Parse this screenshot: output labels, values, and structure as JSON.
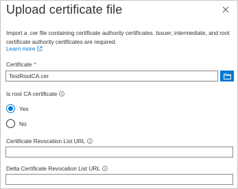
{
  "panel": {
    "title": "Upload certificate file",
    "close_icon": "close-icon",
    "description": "Import a .cer file containing certificate authority certificates. Issuer, intermediate, and root certificate authority certificates are required.",
    "learn_more": "Learn more",
    "learn_more_icon": "external-link-icon"
  },
  "form": {
    "certificate": {
      "label": "Certificate",
      "required_marker": "*",
      "value": "TestRootCA.cer",
      "browse_icon": "folder-icon"
    },
    "root_ca": {
      "label": "Is root CA certificate",
      "options": [
        "Yes",
        "No"
      ],
      "selected": "Yes"
    },
    "crl_url": {
      "label": "Certificate Revocation List URL",
      "value": ""
    },
    "delta_crl_url": {
      "label": "Delta Certificate Revocation List URL",
      "value": ""
    }
  },
  "colors": {
    "accent": "#0078d4",
    "required": "#a4262c",
    "text": "#323130",
    "border": "#8a8886"
  }
}
